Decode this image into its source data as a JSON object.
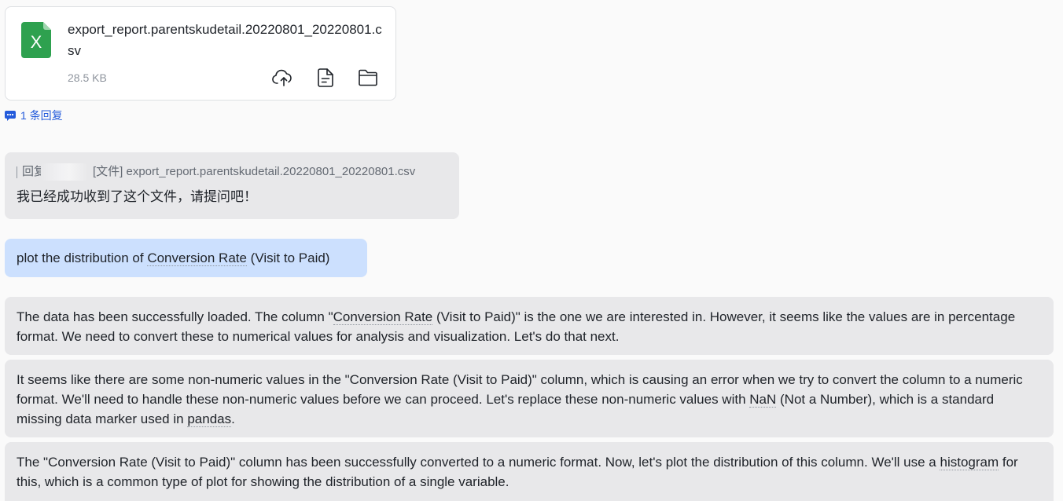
{
  "file_card": {
    "name": "export_report.parentskudetail.20220801_20220801.csv",
    "size": "28.5 KB",
    "icon_letter": "X",
    "icon_color": "#2ea14f",
    "actions": [
      {
        "name": "cloud-upload-icon"
      },
      {
        "name": "document-icon"
      },
      {
        "name": "folder-icon"
      }
    ]
  },
  "reply_link": {
    "label": "1 条回复",
    "color": "#245bdb"
  },
  "quote": {
    "prefix": "回复",
    "ref": "[文件] export_report.parentskudetail.20220801_20220801.csv",
    "text": "我已经成功收到了这个文件，请提问吧！"
  },
  "user_message": {
    "before": "plot the distribution of ",
    "term": "Conversion Rate",
    "after": " (Visit to Paid)",
    "bg": "#cce0fe"
  },
  "ai_messages": [
    {
      "p1": "The data has been successfully loaded. The column \"",
      "t1": "Conversion Rate",
      "p2": " (Visit to Paid)\" is the one we are interested in. However, it seems like the values are in percentage format. We need to convert these to numerical values for analysis and visualization. Let's do that next."
    },
    {
      "p1": "It seems like there are some non-numeric values in the \"Conversion Rate (Visit to Paid)\" column, which is causing an error when we try to convert the column to a numeric format. We'll need to handle these non-numeric values before we can proceed. Let's replace these non-numeric values with ",
      "t1": "NaN",
      "p2": " (Not a Number), which is a standard missing data marker used in ",
      "t2": "pandas",
      "p3": "."
    },
    {
      "p1": "The \"Conversion Rate (Visit to Paid)\" column has been successfully converted to a numeric format. Now, let's plot the distribution of this column. We'll use a ",
      "t1": "histogram",
      "p2": " for this, which is a common type of plot for showing the distribution of a single variable."
    }
  ]
}
